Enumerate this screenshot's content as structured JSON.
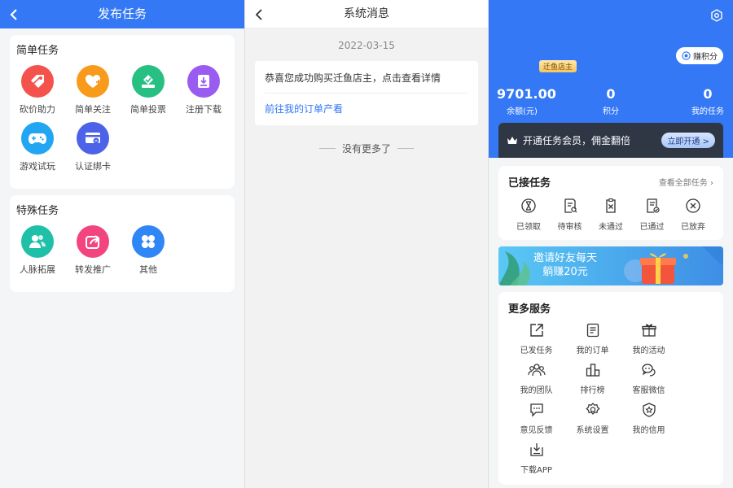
{
  "publish": {
    "title": "发布任务",
    "simple_title": "简单任务",
    "simple_items": [
      {
        "label": "砍价助力",
        "icon": "tag-icon",
        "color": "#f4524d"
      },
      {
        "label": "简单关注",
        "icon": "heart-plus-icon",
        "color": "#f89a1c"
      },
      {
        "label": "简单投票",
        "icon": "vote-box-icon",
        "color": "#27c082"
      },
      {
        "label": "注册下载",
        "icon": "download-icon",
        "color": "#9a5cf0"
      },
      {
        "label": "游戏试玩",
        "icon": "gamepad-icon",
        "color": "#22a6f2"
      },
      {
        "label": "认证绑卡",
        "icon": "card-link-icon",
        "color": "#4c62e8"
      }
    ],
    "special_title": "特殊任务",
    "special_items": [
      {
        "label": "人脉拓展",
        "icon": "people-icon",
        "color": "#1fbfa8"
      },
      {
        "label": "转发推广",
        "icon": "share-icon",
        "color": "#f2457f"
      },
      {
        "label": "其他",
        "icon": "clover-icon",
        "color": "#2f86f6"
      }
    ]
  },
  "messages": {
    "title": "系统消息",
    "date": "2022-03-15",
    "msg_text": "恭喜您成功购买迁鱼店主，点击查看详情",
    "msg_link": "前往我的订单产看",
    "no_more": "没有更多了"
  },
  "profile": {
    "badge": "迁鱼店主",
    "earn_button": "赚积分",
    "stats": [
      {
        "value": "9701.00",
        "label": "余额(元)"
      },
      {
        "value": "0",
        "label": "积分"
      },
      {
        "value": "0",
        "label": "我的任务"
      }
    ],
    "vip_text": "开通任务会员，佣金翻倍",
    "vip_button": "立即开通 >",
    "accepted_title": "已接任务",
    "view_all": "查看全部任务",
    "accepted_items": [
      {
        "label": "已领取",
        "icon": "hourglass-icon"
      },
      {
        "label": "待审核",
        "icon": "review-doc-icon"
      },
      {
        "label": "未通过",
        "icon": "reject-doc-icon"
      },
      {
        "label": "已通过",
        "icon": "approved-doc-icon"
      },
      {
        "label": "已放弃",
        "icon": "cancel-circle-icon"
      }
    ],
    "banner_line1": "邀请好友每天",
    "banner_line2": "躺赚20元",
    "more_title": "更多服务",
    "services": [
      {
        "label": "已发任务",
        "icon": "external-link-icon"
      },
      {
        "label": "我的订单",
        "icon": "order-list-icon"
      },
      {
        "label": "我的活动",
        "icon": "gift-icon"
      },
      {
        "label": "我的团队",
        "icon": "team-icon"
      },
      {
        "label": "排行榜",
        "icon": "ranking-icon"
      },
      {
        "label": "客服微信",
        "icon": "wechat-icon"
      },
      {
        "label": "意见反馈",
        "icon": "feedback-icon"
      },
      {
        "label": "系统设置",
        "icon": "gear-icon"
      },
      {
        "label": "我的信用",
        "icon": "credit-shield-icon"
      },
      {
        "label": "下载APP",
        "icon": "app-download-icon"
      }
    ]
  }
}
